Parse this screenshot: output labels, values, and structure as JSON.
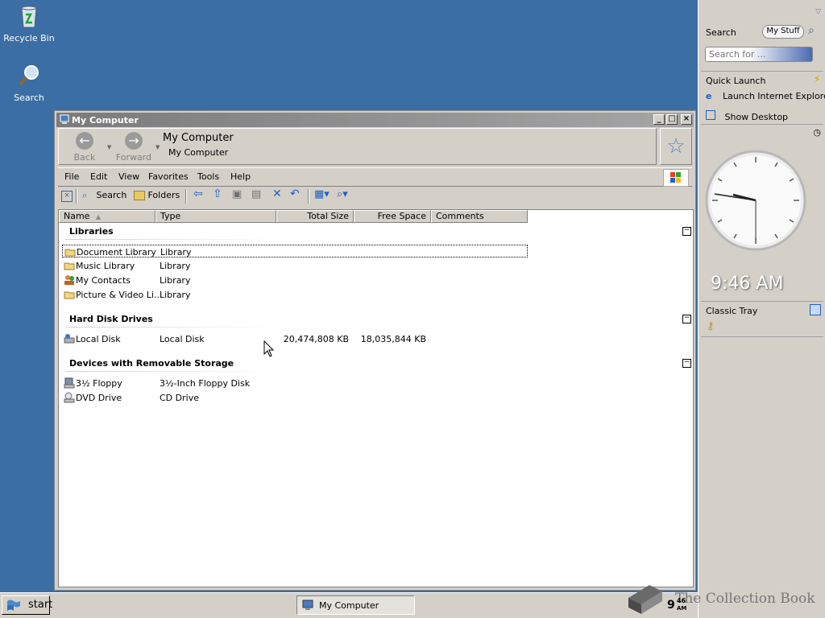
{
  "desktop": {
    "icons": [
      {
        "label": "Recycle Bin",
        "icon": "recycle-bin-icon"
      },
      {
        "label": "Search",
        "icon": "search-icon"
      }
    ]
  },
  "window": {
    "title": "My Computer",
    "nav": {
      "back_label": "Back",
      "forward_label": "Forward",
      "location_title": "My Computer",
      "location_sub": "My Computer"
    },
    "menu": [
      "File",
      "Edit",
      "View",
      "Favorites",
      "Tools",
      "Help"
    ],
    "toolbar": {
      "search_label": "Search",
      "folders_label": "Folders"
    },
    "columns": [
      "Name",
      "Type",
      "Total Size",
      "Free Space",
      "Comments"
    ],
    "groups": [
      {
        "title": "Libraries",
        "items": [
          {
            "name": "Document Library",
            "type": "Library",
            "total": "",
            "free": "",
            "icon": "library-icon"
          },
          {
            "name": "Music Library",
            "type": "Library",
            "total": "",
            "free": "",
            "icon": "library-icon"
          },
          {
            "name": "My Contacts",
            "type": "Library",
            "total": "",
            "free": "",
            "icon": "contacts-icon"
          },
          {
            "name": "Picture & Video Li...",
            "type": "Library",
            "total": "",
            "free": "",
            "icon": "library-icon"
          }
        ]
      },
      {
        "title": "Hard Disk Drives",
        "items": [
          {
            "name": "Local Disk",
            "type": "Local Disk",
            "total": "20,474,808 KB",
            "free": "18,035,844 KB",
            "icon": "hard-disk-icon"
          }
        ]
      },
      {
        "title": "Devices with Removable Storage",
        "items": [
          {
            "name": "3½ Floppy",
            "type": "3½-Inch Floppy Disk",
            "total": "",
            "free": "",
            "icon": "floppy-icon"
          },
          {
            "name": "DVD Drive",
            "type": "CD Drive",
            "total": "",
            "free": "",
            "icon": "dvd-drive-icon"
          }
        ]
      }
    ]
  },
  "sidebar": {
    "search_title": "Search",
    "my_stuff_label": "My Stuff",
    "search_placeholder": "Search for ...",
    "quick_launch_title": "Quick Launch",
    "quick_launch_items": [
      "Launch Internet Explorer",
      "Show Desktop"
    ],
    "clock_time": "9:46 AM",
    "classic_tray_title": "Classic Tray"
  },
  "taskbar": {
    "start_label": "start",
    "task_label": "My Computer",
    "clock_hour": "9",
    "clock_min": "46",
    "clock_ampm": "AM",
    "watermark": "The Collection Book"
  },
  "colors": {
    "desktop": "#3a6ea5",
    "titlebar_inactive": "#8a8a8a"
  }
}
